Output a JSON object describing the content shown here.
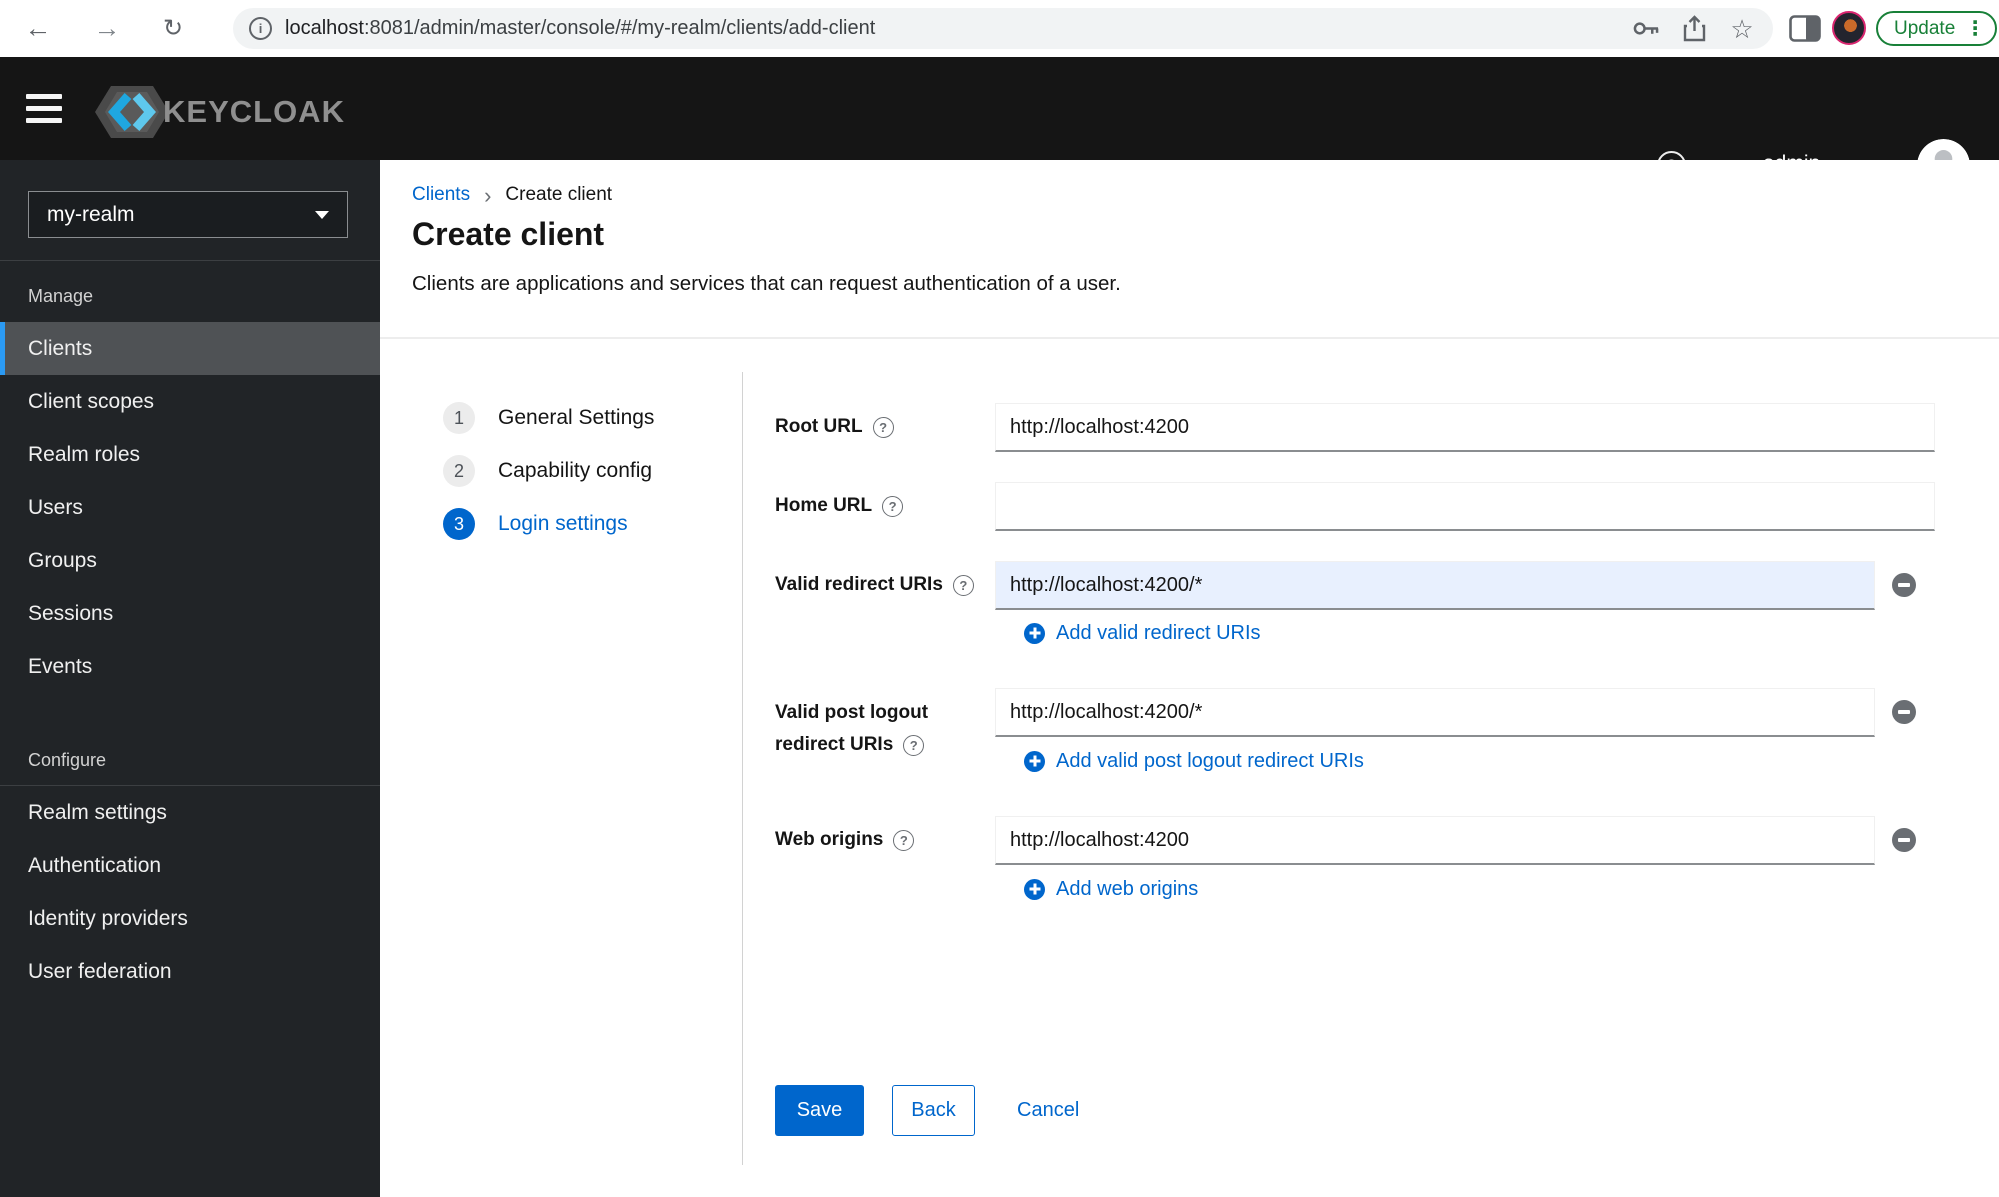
{
  "browser": {
    "url_host": "localhost",
    "url_path": ":8081/admin/master/console/#/my-realm/clients/add-client",
    "update_label": "Update"
  },
  "header": {
    "brand": "KEYCLOAK",
    "username": "admin"
  },
  "sidebar": {
    "realm_selector": "my-realm",
    "manage": {
      "label": "Manage",
      "items": [
        "Clients",
        "Client scopes",
        "Realm roles",
        "Users",
        "Groups",
        "Sessions",
        "Events"
      ]
    },
    "configure": {
      "label": "Configure",
      "items": [
        "Realm settings",
        "Authentication",
        "Identity providers",
        "User federation"
      ]
    }
  },
  "breadcrumb": {
    "parent": "Clients",
    "current": "Create client"
  },
  "page": {
    "title": "Create client",
    "subtitle": "Clients are applications and services that can request authentication of a user."
  },
  "wizard": {
    "steps": [
      {
        "number": "1",
        "label": "General Settings"
      },
      {
        "number": "2",
        "label": "Capability config"
      },
      {
        "number": "3",
        "label": "Login settings"
      }
    ]
  },
  "form": {
    "root_url": {
      "label": "Root URL",
      "value": "http://localhost:4200"
    },
    "home_url": {
      "label": "Home URL",
      "value": ""
    },
    "redirect_uris": {
      "label": "Valid redirect URIs",
      "value": "http://localhost:4200/*",
      "add_label": "Add valid redirect URIs"
    },
    "post_logout_uris": {
      "label_line1": "Valid post logout",
      "label_line2": "redirect URIs",
      "value": "http://localhost:4200/*",
      "add_label": "Add valid post logout redirect URIs"
    },
    "web_origins": {
      "label": "Web origins",
      "value": "http://localhost:4200",
      "add_label": "Add web origins"
    },
    "actions": {
      "save": "Save",
      "back": "Back",
      "cancel": "Cancel"
    }
  },
  "icons": {
    "back": "←",
    "forward": "→",
    "reload": "↻",
    "star": "☆",
    "menu_dots": "⋮",
    "breadcrumb_sep": "›",
    "help": "?",
    "info": "i"
  },
  "colors": {
    "accent": "#0066cc",
    "header_bg": "#151515",
    "sidebar_bg": "#212427",
    "active_nav_bg": "#4f5255",
    "active_nav_border": "#2b9af3",
    "update_green": "#188038",
    "input_autofill_bg": "#e8f0fe",
    "minus_gray": "#6a6e73"
  }
}
